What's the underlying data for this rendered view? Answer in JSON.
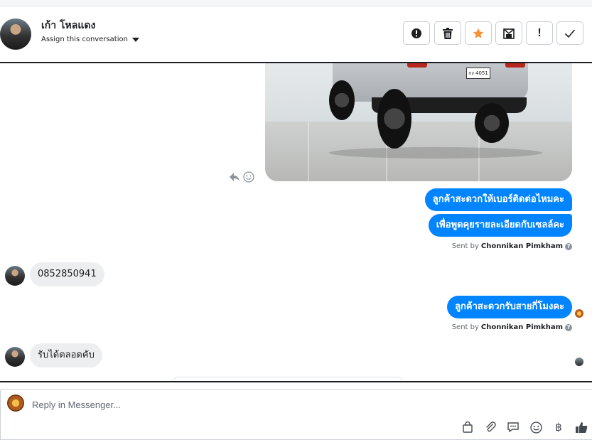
{
  "header": {
    "contact_name": "เก้า โหลแดง",
    "assign_label": "Assign this conversation",
    "toolbar": [
      {
        "name": "spam-button",
        "icon": "alert-circle-icon"
      },
      {
        "name": "delete-button",
        "icon": "trash-icon"
      },
      {
        "name": "star-button",
        "icon": "star-icon",
        "color": "#f7923a"
      },
      {
        "name": "mark-unread-button",
        "icon": "envelope-icon"
      },
      {
        "name": "follow-up-button",
        "icon": "exclamation-icon"
      },
      {
        "name": "done-button",
        "icon": "check-icon"
      }
    ],
    "follow_up_glyph": "!"
  },
  "messages": {
    "image_plate": "กง 4051",
    "out_1": "ลูกค้าสะดวกให้เบอร์ติดต่อไหมคะ",
    "out_2": "เพื่อพูดคุยรายละเอียดกับเซลล์คะ",
    "sent_by_prefix": "Sent by",
    "sender_name": "Chonnikan Pimkham",
    "in_1": "0852850941",
    "out_3": "ลูกค้าสะดวกรับสายกี่โมงคะ",
    "sent_by_prefix_2": "Sent by",
    "sender_name_2": "Chonnikan Pimkham",
    "in_2": "รับได้ตลอดคับ"
  },
  "composer": {
    "placeholder": "Reply in Messenger...",
    "tools": [
      "shop-bag-icon",
      "paperclip-icon",
      "saved-reply-icon",
      "emoji-icon",
      "baht-icon",
      "thumbs-up-icon"
    ],
    "baht_glyph": "฿"
  },
  "colors": {
    "accent": "#0084ff",
    "incoming_bubble": "#eceef0",
    "star": "#f7923a"
  }
}
